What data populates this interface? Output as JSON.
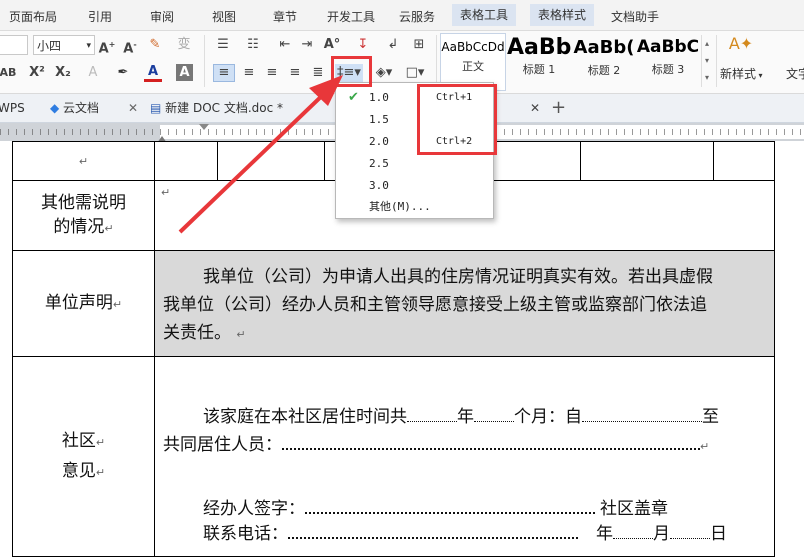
{
  "menubar": {
    "items": [
      "页面布局",
      "引用",
      "审阅",
      "视图",
      "章节",
      "开发工具",
      "云服务",
      "表格工具",
      "表格样式",
      "文档助手"
    ]
  },
  "ribbon": {
    "font_name": "",
    "font_size": "小四",
    "styles": [
      {
        "sample": "AaBbCcDd",
        "name": "正文"
      },
      {
        "sample": "AaBb",
        "name": "标题 1"
      },
      {
        "sample": "AaBb(",
        "name": "标题 2"
      },
      {
        "sample": "AaBbC",
        "name": "标题 3"
      }
    ],
    "new_style": "新样式",
    "text_label": "文字"
  },
  "tabs": {
    "items": [
      "WPS",
      "云文档",
      "新建 DOC 文档.doc *"
    ],
    "new_tab": "+"
  },
  "line_spacing_menu": {
    "options": [
      {
        "value": "1.0",
        "shortcut": "Ctrl+1",
        "checked": true
      },
      {
        "value": "1.5",
        "shortcut": ""
      },
      {
        "value": "2.0",
        "shortcut": "Ctrl+2"
      },
      {
        "value": "2.5",
        "shortcut": ""
      },
      {
        "value": "3.0",
        "shortcut": ""
      }
    ],
    "other": "其他(M)..."
  },
  "document": {
    "row_other": {
      "label_line1": "其他需说明",
      "label_line2": "的情况"
    },
    "row_unit": {
      "label": "单位声明",
      "line1": "我单位（公司）为申请人出具的住房情况证明真实有效。若出具虚假",
      "line2": "我单位（公司）经办人员和主管领导愿意接受上级主管或监察部门依法追",
      "line3": "关责任。"
    },
    "row_community": {
      "label_line1": "社区",
      "label_line2": "意见",
      "line1_a": "该家庭在本社区居住时间共",
      "line1_b": "年",
      "line1_c": "个月：自",
      "line1_d": "至",
      "line2": "共同居住人员：",
      "line3_a": "经办人签字：",
      "line3_b": "社区盖章",
      "line4_a": "联系电话：",
      "line4_b": "年",
      "line4_c": "月",
      "line4_d": "日"
    },
    "paragraph_mark": "↵"
  },
  "colors": {
    "accent_red": "#e8373a",
    "table_gray": "#d9d9d9",
    "check_green": "#3aa84a"
  }
}
